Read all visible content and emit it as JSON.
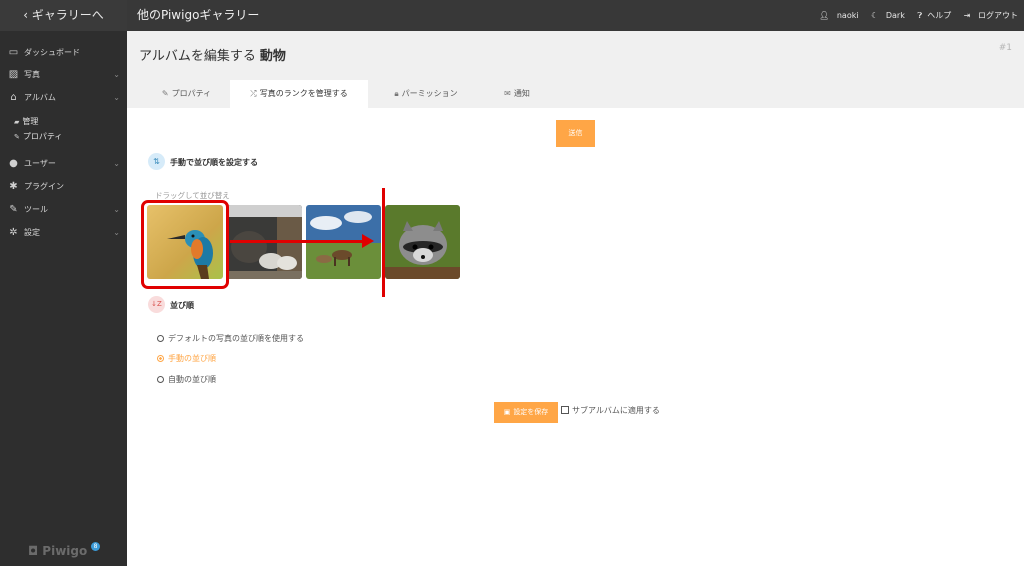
{
  "sidebar": {
    "back_label": "‹ ギャラリーへ",
    "items": [
      {
        "icon": "monitor-icon",
        "glyph": "▭",
        "label": "ダッシュボード",
        "chevron": ""
      },
      {
        "icon": "photo-icon",
        "glyph": "▨",
        "label": "写真",
        "chevron": "⌄"
      },
      {
        "icon": "sitemap-icon",
        "glyph": "⌂",
        "label": "アルバム",
        "chevron": "⌄"
      },
      {
        "icon": "users-icon",
        "glyph": "●",
        "label": "ユーザー",
        "chevron": "⌄"
      },
      {
        "icon": "puzzle-icon",
        "glyph": "✱",
        "label": "プラグイン",
        "chevron": ""
      },
      {
        "icon": "wrench-icon",
        "glyph": "✎",
        "label": "ツール",
        "chevron": "⌄"
      },
      {
        "icon": "gear-icon",
        "glyph": "✲",
        "label": "設定",
        "chevron": "⌄"
      }
    ],
    "album_sub": [
      {
        "icon": "folder-icon",
        "glyph": "▰",
        "label": "管理"
      },
      {
        "icon": "pencil-icon",
        "glyph": "✎",
        "label": "プロパティ"
      }
    ],
    "logo": "Piwigo",
    "logo_badge": "8"
  },
  "topbar": {
    "title": "他のPiwigoギャラリー",
    "user": "naoki",
    "theme": "Dark",
    "help": "ヘルプ",
    "logout": "ログアウト"
  },
  "header": {
    "title": "アルバムを編集する",
    "album_name": "動物",
    "album_id": "#1",
    "tabs": [
      {
        "label": "プロパティ",
        "glyph": "✎",
        "icon": "pencil-icon"
      },
      {
        "label": "写真のランクを管理する",
        "glyph": "⤮",
        "icon": "shuffle-icon"
      },
      {
        "label": "パーミッション",
        "glyph": "🔒︎",
        "icon": "lock-icon"
      },
      {
        "label": "通知",
        "glyph": "✉",
        "icon": "envelope-icon"
      }
    ]
  },
  "content": {
    "submit_label": "送信",
    "manual_section_title": "手動で並び順を設定する",
    "drag_label": "ドラッグして並び替え",
    "sort_section_title": "並び順",
    "sort_options": [
      {
        "label": "デフォルトの写真の並び順を使用する",
        "selected": false
      },
      {
        "label": "手動の並び順",
        "selected": true
      },
      {
        "label": "自動の並び順",
        "selected": false
      }
    ],
    "save_label": "設定を保存",
    "apply_sub_label": "サブアルバムに適用する",
    "photos": [
      {
        "name": "kingfisher",
        "icon": "kingfisher-photo"
      },
      {
        "name": "sheep",
        "icon": "sheep-photo"
      },
      {
        "name": "horses",
        "icon": "horses-photo"
      },
      {
        "name": "raccoon",
        "icon": "raccoon-photo"
      }
    ]
  },
  "colors": {
    "accent": "#ffa646",
    "sidebar_bg": "#2e2e2e",
    "topbar_bg": "#383838",
    "annotation_red": "#e00000"
  }
}
